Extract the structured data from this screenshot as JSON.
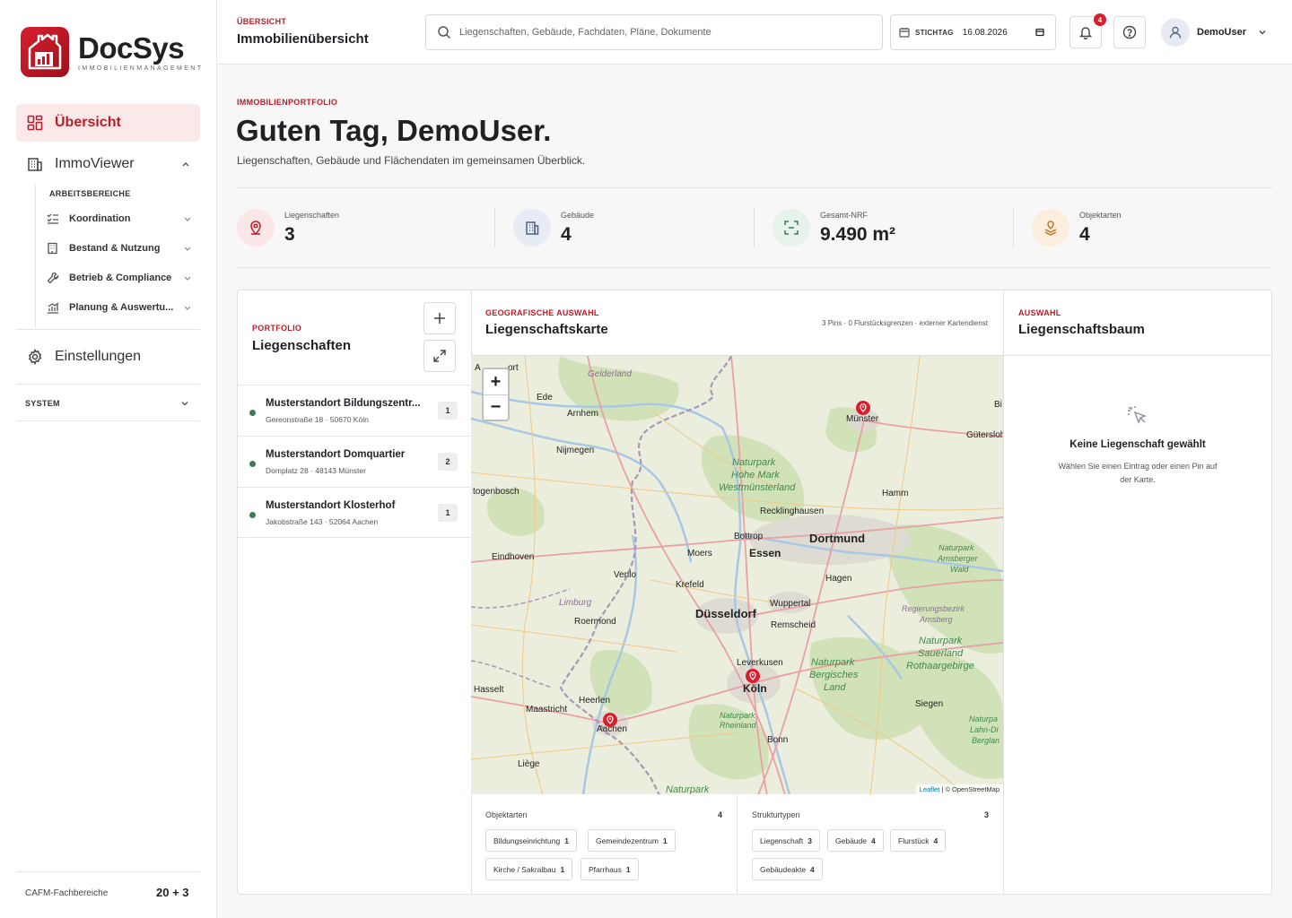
{
  "brand": {
    "name": "DocSys",
    "tagline": "IMMOBILIENMANAGEMENT"
  },
  "sidebar": {
    "overview": "Übersicht",
    "immoviewer": "ImmoViewer",
    "section_label": "ARBEITSBEREICHE",
    "sub_items": [
      {
        "label": "Koordination",
        "icon": "checklist-icon"
      },
      {
        "label": "Bestand & Nutzung",
        "icon": "building-icon"
      },
      {
        "label": "Betrieb & Compliance",
        "icon": "wrench-icon"
      },
      {
        "label": "Planung & Auswertu...",
        "icon": "chart-icon"
      }
    ],
    "settings": "Einstellungen",
    "system": "SYSTEM",
    "footer_label": "CAFM-Fachbereiche",
    "footer_value": "20 + 3"
  },
  "header": {
    "crumb": "ÜBERSICHT",
    "title": "Immobilienübersicht",
    "search_placeholder": "Liegenschaften, Gebäude, Fachdaten, Pläne, Dokumente",
    "date_label": "STICHTAG",
    "date_value": "16.08.2026",
    "notifications": "4",
    "user": "DemoUser"
  },
  "hero": {
    "kicker": "IMMOBILIENPORTFOLIO",
    "greeting": "Guten Tag, DemoUser.",
    "subtitle": "Liegenschaften, Gebäude und Flächendaten im gemeinsamen Überblick."
  },
  "stats": [
    {
      "label": "Liegenschaften",
      "value": "3",
      "icon": "location-pin-icon",
      "color": "#fbe7e8"
    },
    {
      "label": "Gebäude",
      "value": "4",
      "icon": "building-icon",
      "color": "#e7ecf4"
    },
    {
      "label": "Gesamt-NRF",
      "value": "9.490 m²",
      "icon": "area-scan-icon",
      "color": "#e6f2ea"
    },
    {
      "label": "Objektarten",
      "value": "4",
      "icon": "layers-pin-icon",
      "color": "#fbeede"
    }
  ],
  "portfolio": {
    "kicker": "PORTFOLIO",
    "title": "Liegenschaften",
    "items": [
      {
        "name": "Musterstandort Bildungszentr...",
        "address": "Gereonstraße 18 · 50670 Köln",
        "count": "1"
      },
      {
        "name": "Musterstandort Domquartier",
        "address": "Domplatz 28 · 48143 Münster",
        "count": "2"
      },
      {
        "name": "Musterstandort Klosterhof",
        "address": "Jakobstraße 143 · 52064 Aachen",
        "count": "1"
      }
    ]
  },
  "map": {
    "kicker": "GEOGRAFISCHE AUSWAHL",
    "title": "Liegenschaftskarte",
    "meta": "3 Pins · 0 Flurstücksgrenzen · externer Kartendienst",
    "zoom_in": "+",
    "zoom_out": "−",
    "attribution_leaflet": "Leaflet",
    "attribution_osm": "| © OpenStreetMap",
    "cities": [
      {
        "name": "Münster",
        "big": false
      },
      {
        "name": "Dortmund",
        "big": true
      },
      {
        "name": "Essen",
        "big": true
      },
      {
        "name": "Düsseldorf",
        "big": true
      },
      {
        "name": "Köln",
        "big": true
      },
      {
        "name": "Aachen",
        "big": false
      },
      {
        "name": "Bonn",
        "big": false
      },
      {
        "name": "Hamm",
        "big": false
      },
      {
        "name": "Recklinghausen",
        "big": false
      },
      {
        "name": "Bottrop",
        "big": false
      },
      {
        "name": "Moers",
        "big": false
      },
      {
        "name": "Krefeld",
        "big": false
      },
      {
        "name": "Wuppertal",
        "big": false
      },
      {
        "name": "Remscheid",
        "big": false
      },
      {
        "name": "Hagen",
        "big": false
      },
      {
        "name": "Leverkusen",
        "big": false
      },
      {
        "name": "Siegen",
        "big": false
      },
      {
        "name": "Venlo",
        "big": false
      },
      {
        "name": "Roermond",
        "big": false
      },
      {
        "name": "Eindhoven",
        "big": false
      },
      {
        "name": "Nijmegen",
        "big": false
      },
      {
        "name": "Arnhem",
        "big": false
      },
      {
        "name": "Ede",
        "big": false
      },
      {
        "name": "Heerlen",
        "big": false
      },
      {
        "name": "Maastricht",
        "big": false
      },
      {
        "name": "Hasselt",
        "big": false
      },
      {
        "name": "Liège",
        "big": false
      },
      {
        "name": "Gütersloh",
        "big": false
      },
      {
        "name": "Bi",
        "big": false
      },
      {
        "name": "togenbosch",
        "big": false
      },
      {
        "name": "A",
        "big": false
      },
      {
        "name": "ort",
        "big": false
      }
    ],
    "regions": [
      "Gelderland",
      "Naturpark",
      "Hohe Mark",
      "Westmünsterland",
      "Limburg",
      "Naturpark",
      "Arnsberger",
      "Wald",
      "Regierungsbezirk",
      "Arnsberg",
      "Naturpark",
      "Sauerland",
      "Rothaargebirge",
      "Naturpark",
      "Bergisches",
      "Land",
      "Naturpark",
      "Rheinland",
      "Naturpa",
      "Lahn-Di",
      "Berglan",
      "Naturpark"
    ]
  },
  "meta_objektarten": {
    "title": "Objektarten",
    "count": "4",
    "chips": [
      {
        "label": "Bildungseinrichtung",
        "n": "1"
      },
      {
        "label": "Gemeindezentrum",
        "n": "1"
      },
      {
        "label": "Kirche / Sakralbau",
        "n": "1"
      },
      {
        "label": "Pfarrhaus",
        "n": "1"
      }
    ]
  },
  "meta_strukturtypen": {
    "title": "Strukturtypen",
    "count": "3",
    "chips": [
      {
        "label": "Liegenschaft",
        "n": "3"
      },
      {
        "label": "Gebäude",
        "n": "4"
      },
      {
        "label": "Flurstück",
        "n": "4"
      },
      {
        "label": "Gebäudeakte",
        "n": "4"
      }
    ]
  },
  "tree": {
    "kicker": "AUSWAHL",
    "title": "Liegenschaftsbaum",
    "empty_title": "Keine Liegenschaft gewählt",
    "empty_sub": "Wählen Sie einen Eintrag oder einen Pin auf der Karte."
  }
}
